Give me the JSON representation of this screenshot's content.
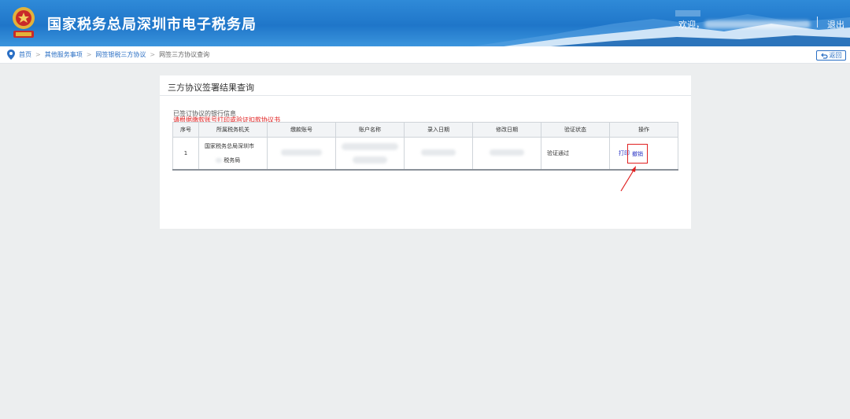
{
  "header": {
    "title": "国家税务总局深圳市电子税务局",
    "welcome": "欢迎，",
    "logout": "退出",
    "emblem_icon": "tax-emblem-icon",
    "colors": {
      "header_blue": "#1f76c9",
      "accent_red": "#e01b1b",
      "link_blue": "#2a6fc4"
    }
  },
  "breadcrumb": {
    "items": [
      "首页",
      "其他服务事项",
      "网签银税三方协议"
    ],
    "current": "网签三方协议查询",
    "back_label": "返回"
  },
  "panel": {
    "title": "三方协议签署结果查询",
    "section_label": "已签订协议的银行信息",
    "notice": "请根据缴款账号打印或验证扣款协议书"
  },
  "table": {
    "columns": [
      "序号",
      "所属税务机关",
      "缴款账号",
      "账户名称",
      "录入日期",
      "修改日期",
      "验证状态",
      "操作"
    ],
    "rows": [
      {
        "index": "1",
        "org_line1": "国家税务总局深圳市",
        "org_line2": "税务局",
        "status": "验证通过",
        "action_print": "打印",
        "action_revoke": "撤销"
      }
    ]
  }
}
